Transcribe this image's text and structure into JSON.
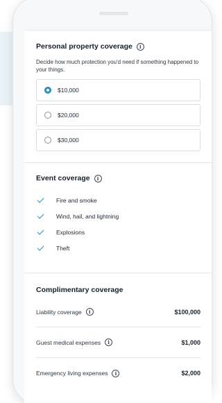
{
  "property": {
    "title": "Personal property coverage",
    "info_icon": "ⓘ",
    "description": "Decide how much protection you'd need if something happened to your things.",
    "options": [
      {
        "label": "$10,000",
        "selected": true
      },
      {
        "label": "$20,000",
        "selected": false
      },
      {
        "label": "$30,000",
        "selected": false
      }
    ]
  },
  "event": {
    "title": "Event coverage",
    "info_icon": "ⓘ",
    "items": [
      "Fire and smoke",
      "Wind, hail, and lightning",
      "Explosions",
      "Theft"
    ]
  },
  "complimentary": {
    "title": "Complimentary coverage",
    "rows": [
      {
        "label": "Liability coverage",
        "info_icon": "ⓘ",
        "value": "$100,000"
      },
      {
        "label": "Guest medical expenses",
        "info_icon": "ⓘ",
        "value": "$1,000"
      },
      {
        "label": "Emergency living expenses",
        "info_icon": "ⓘ",
        "value": "$2,000"
      }
    ]
  },
  "colors": {
    "accent": "#2b8fb6",
    "band": "#eaf3f7"
  }
}
